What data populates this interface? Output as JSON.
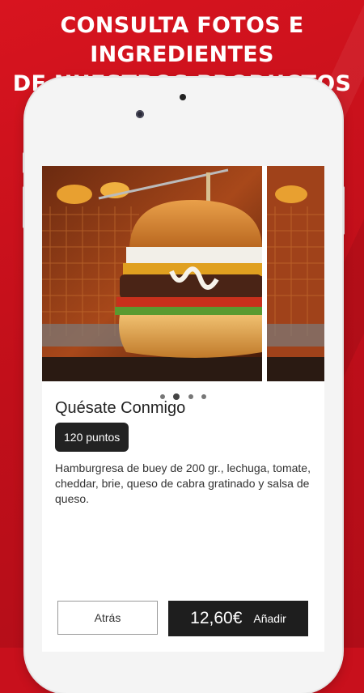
{
  "headline": {
    "line1": "CONSULTA FOTOS E INGREDIENTES",
    "line2": "DE NUESTROS PRODUCTOS"
  },
  "product": {
    "name": "Quésate Conmigo",
    "points": "120 puntos",
    "description": "Hamburgresa de buey de 200 gr., lechuga, tomate, cheddar, brie, queso de cabra gratinado y salsa de queso.",
    "image_icon": "burger-photo"
  },
  "carousel": {
    "total": 4,
    "active": 1
  },
  "actions": {
    "back_label": "Atrás",
    "price": "12,60€",
    "add_label": "Añadir"
  },
  "colors": {
    "brand_red": "#c8101c",
    "dark": "#1e1e1e"
  }
}
